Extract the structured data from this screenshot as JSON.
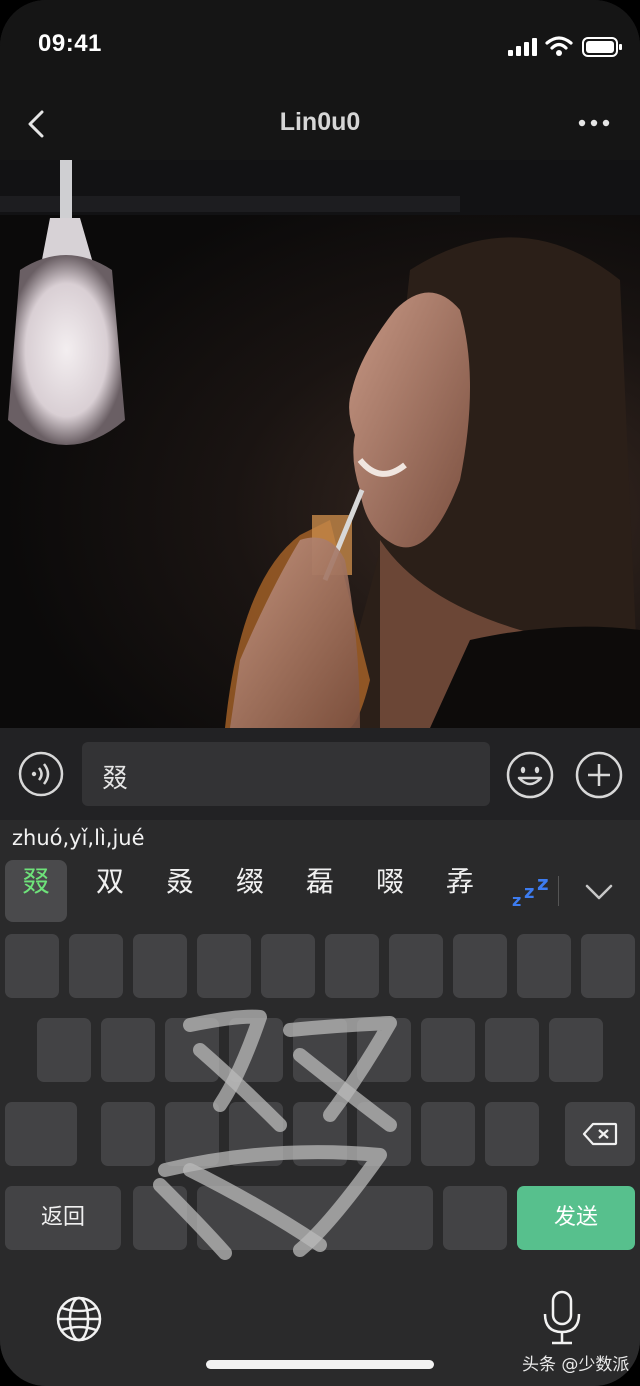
{
  "status_bar": {
    "time": "09:41"
  },
  "nav": {
    "title": "Lin0u0",
    "back_icon": "chevron-left-icon",
    "more_icon": "ellipsis-icon"
  },
  "chat": {
    "image_alt": "woman-drinking-through-straw-photo"
  },
  "input": {
    "value": "叕"
  },
  "keyboard": {
    "pinyin": "zhuó,yǐ,lì,jué",
    "candidates": [
      "叕",
      "双",
      "叒",
      "缀",
      "磊",
      "啜",
      "孨"
    ],
    "selected_candidate_color": "#6ee37a",
    "return_label": "返回",
    "send_label": "发送",
    "send_color": "#57c08d"
  },
  "watermark": "头条 @少数派"
}
